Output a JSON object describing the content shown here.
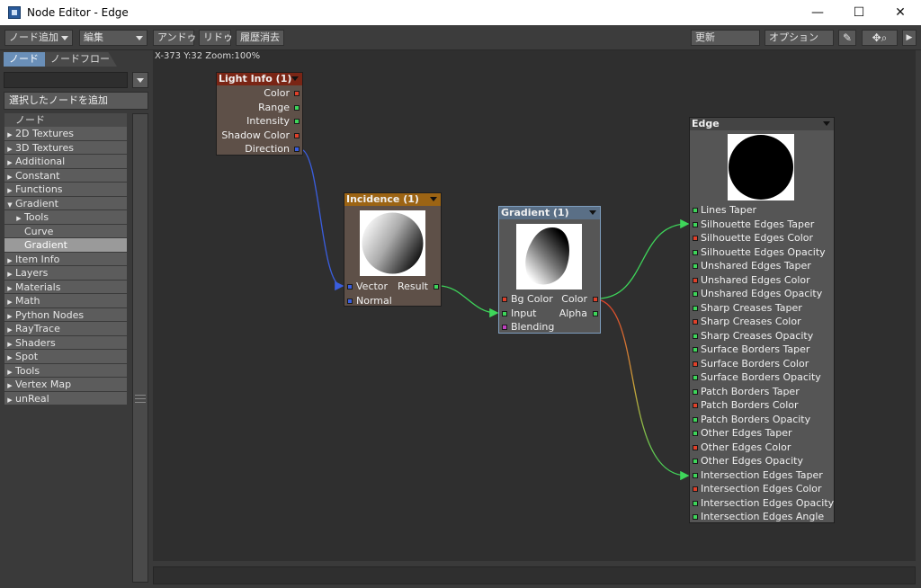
{
  "window": {
    "title": "Node Editor - Edge",
    "controls": {
      "minimize": "—",
      "maximize": "☐",
      "close": "✕"
    }
  },
  "toolbar": {
    "add_node": "ノード追加",
    "edit": "編集",
    "undo": "アンドゥ",
    "redo": "リドゥ",
    "clear_history": "履歴消去",
    "update": "更新",
    "options": "オプション",
    "icons": [
      "brush-icon",
      "move-icon",
      "zoom-icon",
      "play-icon"
    ]
  },
  "left_panel": {
    "tabs": [
      "ノード",
      "ノードフロー"
    ],
    "search_value": "",
    "add_selected": "選択したノードを追加",
    "tree_header": "ノード",
    "tree": [
      {
        "label": "2D Textures",
        "arrow": "▶",
        "level": 0
      },
      {
        "label": "3D Textures",
        "arrow": "▶",
        "level": 0
      },
      {
        "label": "Additional",
        "arrow": "▶",
        "level": 0
      },
      {
        "label": "Constant",
        "arrow": "▶",
        "level": 0
      },
      {
        "label": "Functions",
        "arrow": "▶",
        "level": 0
      },
      {
        "label": "Gradient",
        "arrow": "▼",
        "level": 0
      },
      {
        "label": "Tools",
        "arrow": "▶",
        "level": 1
      },
      {
        "label": "Curve",
        "arrow": "",
        "level": 2
      },
      {
        "label": "Gradient",
        "arrow": "",
        "level": 2,
        "selected": true
      },
      {
        "label": "Item Info",
        "arrow": "▶",
        "level": 0
      },
      {
        "label": "Layers",
        "arrow": "▶",
        "level": 0
      },
      {
        "label": "Materials",
        "arrow": "▶",
        "level": 0
      },
      {
        "label": "Math",
        "arrow": "▶",
        "level": 0
      },
      {
        "label": "Python Nodes",
        "arrow": "▶",
        "level": 0
      },
      {
        "label": "RayTrace",
        "arrow": "▶",
        "level": 0
      },
      {
        "label": "Shaders",
        "arrow": "▶",
        "level": 0
      },
      {
        "label": "Spot",
        "arrow": "▶",
        "level": 0
      },
      {
        "label": "Tools",
        "arrow": "▶",
        "level": 0
      },
      {
        "label": "Vertex Map",
        "arrow": "▶",
        "level": 0
      },
      {
        "label": "unReal",
        "arrow": "▶",
        "level": 0
      }
    ]
  },
  "canvas": {
    "coords": "X-373 Y:32 Zoom:100%"
  },
  "nodes": {
    "light_info": {
      "title": "Light Info (1)",
      "outputs": [
        {
          "label": "Color",
          "color": "#e0412a"
        },
        {
          "label": "Range",
          "color": "#3ed65a"
        },
        {
          "label": "Intensity",
          "color": "#3ed65a"
        },
        {
          "label": "Shadow Color",
          "color": "#e0412a"
        },
        {
          "label": "Direction",
          "color": "#3a5ee0"
        }
      ]
    },
    "incidence": {
      "title": "Incidence (1)",
      "inputs": [
        {
          "label": "Vector",
          "color": "#3a5ee0"
        },
        {
          "label": "Normal",
          "color": "#3a5ee0"
        }
      ],
      "outputs": [
        {
          "label": "Result",
          "color": "#3ed65a"
        }
      ]
    },
    "gradient": {
      "title": "Gradient (1)",
      "inputs": [
        {
          "label": "Bg Color",
          "color": "#e0412a"
        },
        {
          "label": "Input",
          "color": "#3ed65a"
        },
        {
          "label": "Blending",
          "color": "#c040c0"
        }
      ],
      "outputs": [
        {
          "label": "Color",
          "color": "#e0412a"
        },
        {
          "label": "Alpha",
          "color": "#3ed65a"
        }
      ]
    },
    "edge": {
      "title": "Edge",
      "inputs": [
        {
          "label": "Lines Taper",
          "color": "#3ed65a"
        },
        {
          "label": "Silhouette Edges Taper",
          "color": "#3ed65a"
        },
        {
          "label": "Silhouette Edges Color",
          "color": "#e0412a"
        },
        {
          "label": "Silhouette Edges Opacity",
          "color": "#3ed65a"
        },
        {
          "label": "Unshared Edges Taper",
          "color": "#3ed65a"
        },
        {
          "label": "Unshared Edges Color",
          "color": "#e0412a"
        },
        {
          "label": "Unshared Edges Opacity",
          "color": "#3ed65a"
        },
        {
          "label": "Sharp Creases Taper",
          "color": "#3ed65a"
        },
        {
          "label": "Sharp Creases Color",
          "color": "#e0412a"
        },
        {
          "label": "Sharp Creases Opacity",
          "color": "#3ed65a"
        },
        {
          "label": "Surface Borders Taper",
          "color": "#3ed65a"
        },
        {
          "label": "Surface Borders Color",
          "color": "#e0412a"
        },
        {
          "label": "Surface Borders Opacity",
          "color": "#3ed65a"
        },
        {
          "label": "Patch Borders Taper",
          "color": "#3ed65a"
        },
        {
          "label": "Patch Borders Color",
          "color": "#e0412a"
        },
        {
          "label": "Patch Borders Opacity",
          "color": "#3ed65a"
        },
        {
          "label": "Other Edges Taper",
          "color": "#3ed65a"
        },
        {
          "label": "Other Edges Color",
          "color": "#e0412a"
        },
        {
          "label": "Other Edges Opacity",
          "color": "#3ed65a"
        },
        {
          "label": "Intersection Edges Taper",
          "color": "#3ed65a"
        },
        {
          "label": "Intersection Edges Color",
          "color": "#e0412a"
        },
        {
          "label": "Intersection Edges Opacity",
          "color": "#3ed65a"
        },
        {
          "label": "Intersection Edges Angle",
          "color": "#3ed65a"
        }
      ]
    }
  },
  "colors": {
    "wire_direction": "#3a5ee0",
    "wire_result": "#3ed65a",
    "wire_color_start": "#e0412a",
    "wire_color_end": "#3ed65a"
  }
}
